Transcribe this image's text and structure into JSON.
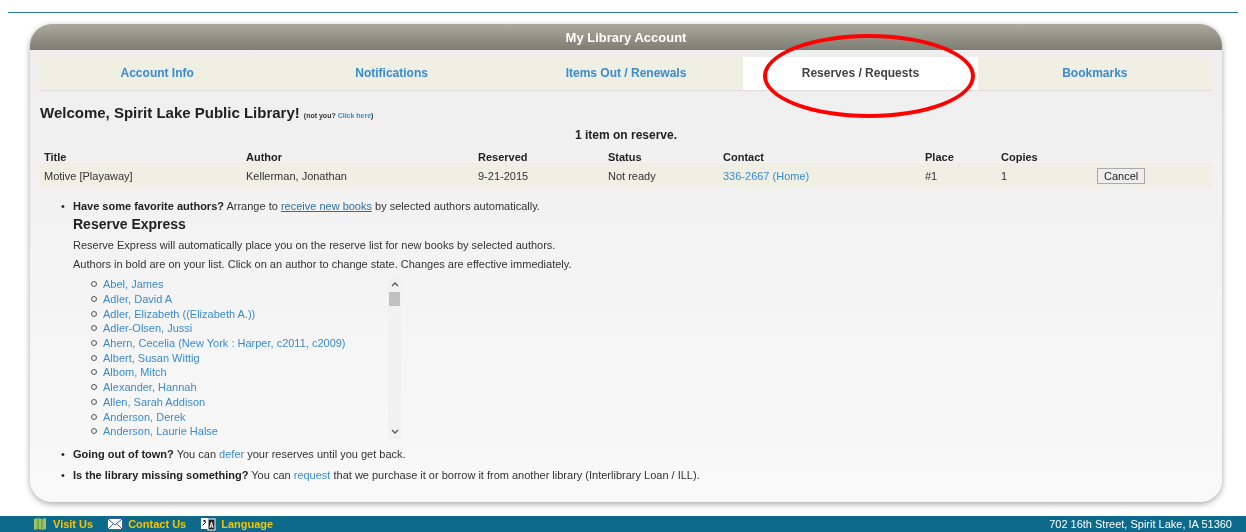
{
  "panel": {
    "title": "My Library Account"
  },
  "tabs": [
    {
      "label": "Account Info",
      "selected": false
    },
    {
      "label": "Notifications",
      "selected": false
    },
    {
      "label": "Items Out / Renewals",
      "selected": false
    },
    {
      "label": "Reserves / Requests",
      "selected": true
    },
    {
      "label": "Bookmarks",
      "selected": false
    }
  ],
  "welcome": {
    "text": "Welcome, Spirit Lake Public Library!",
    "note_before": "(not you?",
    "note_link": "Click here",
    "note_after": ")"
  },
  "reserves": {
    "summary": "1 item on reserve.",
    "columns": [
      "Title",
      "Author",
      "Reserved",
      "Status",
      "Contact",
      "Place",
      "Copies"
    ],
    "rows": [
      {
        "cells": [
          "Motive [Playaway]",
          "Kellerman, Jonathan",
          "9-21-2015",
          "Not ready",
          "336-2667 (Home)",
          "#1",
          "1"
        ],
        "action": "Cancel"
      }
    ]
  },
  "tips": [
    {
      "bullet": "•",
      "lead": "Have some favorite authors?",
      "before": " Arrange to ",
      "link": "receive new books",
      "underlined": true,
      "after": " by selected authors automatically.",
      "kind": "express"
    },
    {
      "bullet": "•",
      "lead": "Going out of town?",
      "before": " You can ",
      "link": "defer",
      "underlined": false,
      "after": " your reserves until you get back.",
      "kind": "plain"
    },
    {
      "bullet": "•",
      "lead": "Is the library missing something?",
      "before": " You can ",
      "link": "request",
      "underlined": false,
      "after": " that we purchase it or borrow it from another library (Interlibrary Loan / ILL).",
      "kind": "plain"
    }
  ],
  "reserve_express": {
    "heading": "Reserve Express",
    "lines": [
      "Reserve Express will automatically place you on the reserve list for new books by selected authors.",
      "Authors in bold are on your list. Click on an author to change state. Changes are effective immediately."
    ],
    "authors": [
      {
        "name": "Abel, James",
        "selected": false
      },
      {
        "name": "Adler, David A",
        "selected": false
      },
      {
        "name": "Adler, Elizabeth ((Elizabeth A.))",
        "selected": false
      },
      {
        "name": "Adler-Olsen, Jussi",
        "selected": false
      },
      {
        "name": "Ahern, Cecelia (New York : Harper, c2011, c2009)",
        "selected": false
      },
      {
        "name": "Albert, Susan Wittig",
        "selected": false
      },
      {
        "name": "Albom, Mitch",
        "selected": false
      },
      {
        "name": "Alexander, Hannah",
        "selected": false
      },
      {
        "name": "Allen, Sarah Addison",
        "selected": false
      },
      {
        "name": "Anderson, Derek",
        "selected": false
      },
      {
        "name": "Anderson, Laurie Halse",
        "selected": false
      }
    ]
  },
  "footer": {
    "links": [
      {
        "label": "Visit Us",
        "kind": "map"
      },
      {
        "label": "Contact Us",
        "kind": "mail"
      },
      {
        "label": "Language",
        "kind": "language"
      }
    ],
    "address": "702 16th Street, Spirit Lake, IA 51360"
  }
}
